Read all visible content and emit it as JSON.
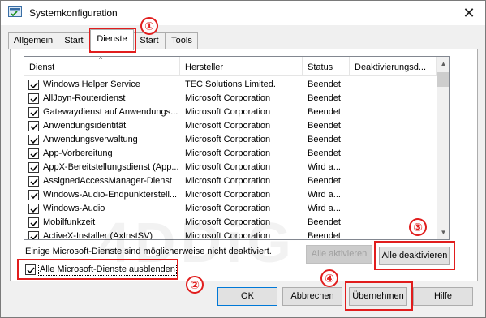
{
  "window": {
    "title": "Systemkonfiguration",
    "close_glyph": "✕"
  },
  "tabs": [
    {
      "label": "Allgemein"
    },
    {
      "label": "Start"
    },
    {
      "label": "Dienste"
    },
    {
      "label": "Start"
    },
    {
      "label": "Tools"
    }
  ],
  "services": {
    "columns": [
      "Dienst",
      "Hersteller",
      "Status",
      "Deaktivierungsd..."
    ],
    "rows": [
      {
        "name": "Windows Helper Service",
        "maker": "TEC Solutions Limited.",
        "status": "Beendet"
      },
      {
        "name": "AllJoyn-Routerdienst",
        "maker": "Microsoft Corporation",
        "status": "Beendet"
      },
      {
        "name": "Gatewaydienst auf Anwendungs...",
        "maker": "Microsoft Corporation",
        "status": "Beendet"
      },
      {
        "name": "Anwendungsidentität",
        "maker": "Microsoft Corporation",
        "status": "Beendet"
      },
      {
        "name": "Anwendungsverwaltung",
        "maker": "Microsoft Corporation",
        "status": "Beendet"
      },
      {
        "name": "App-Vorbereitung",
        "maker": "Microsoft Corporation",
        "status": "Beendet"
      },
      {
        "name": "AppX-Bereitstellungsdienst (App...",
        "maker": "Microsoft Corporation",
        "status": "Wird a..."
      },
      {
        "name": "AssignedAccessManager-Dienst",
        "maker": "Microsoft Corporation",
        "status": "Beendet"
      },
      {
        "name": "Windows-Audio-Endpunkterstell...",
        "maker": "Microsoft Corporation",
        "status": "Wird a..."
      },
      {
        "name": "Windows-Audio",
        "maker": "Microsoft Corporation",
        "status": "Wird a..."
      },
      {
        "name": "Mobilfunkzeit",
        "maker": "Microsoft Corporation",
        "status": "Beendet"
      },
      {
        "name": "ActiveX-Installer (AxInstSV)",
        "maker": "Microsoft Corporation",
        "status": "Beendet"
      }
    ]
  },
  "note": "Einige Microsoft-Dienste sind möglicherweise nicht deaktiviert.",
  "buttons": {
    "enable_all": "Alle aktivieren",
    "disable_all": "Alle deaktivieren",
    "ok": "OK",
    "cancel": "Abbrechen",
    "apply": "Übernehmen",
    "help": "Hilfe"
  },
  "hide_ms": {
    "label": "Alle Microsoft-Dienste ausblenden",
    "checked": true
  },
  "annotations": [
    "①",
    "②",
    "③",
    "④"
  ],
  "watermark": "4DDiG",
  "colors": {
    "annotation_red": "#e11d1d",
    "focus_blue": "#0078d7"
  }
}
